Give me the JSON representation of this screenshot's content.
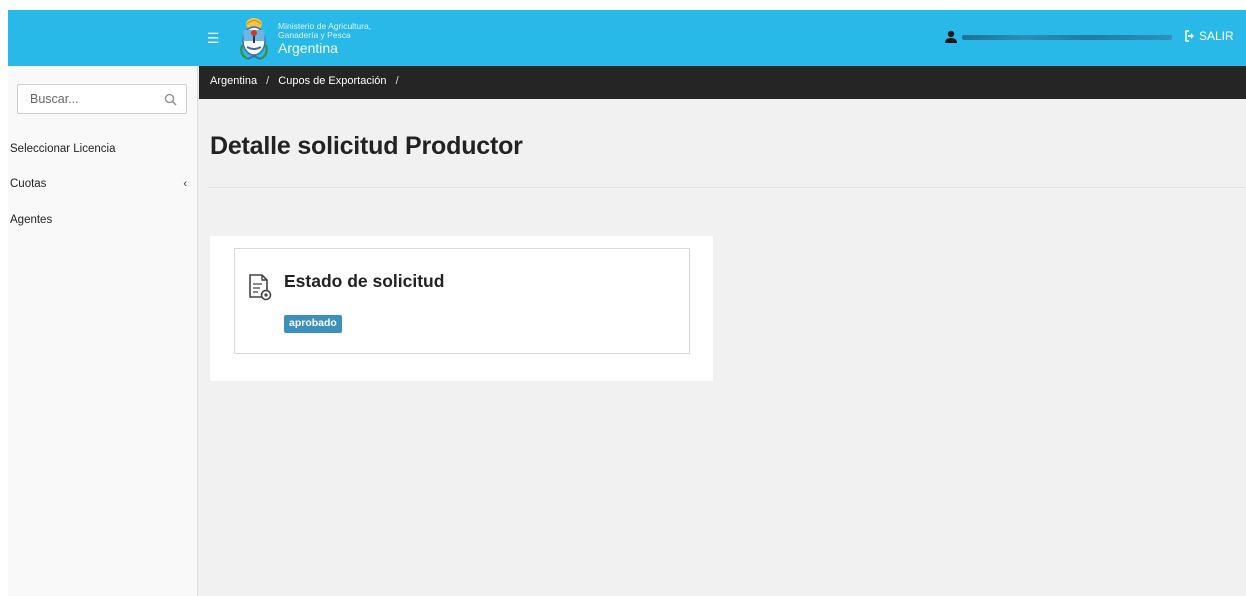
{
  "header": {
    "ministry_line1": "Ministerio de Agricultura,",
    "ministry_line2": "Ganadería y Pesca",
    "country": "Argentina",
    "logout_label": "SALIR"
  },
  "sidebar": {
    "search_placeholder": "Buscar...",
    "items": [
      {
        "label": "Seleccionar Licencia"
      },
      {
        "label": "Cuotas",
        "chevron": "‹"
      },
      {
        "label": "Agentes"
      }
    ]
  },
  "breadcrumb": {
    "items": [
      "Argentina",
      "Cupos de Exportación"
    ],
    "separator": "/"
  },
  "main": {
    "title": "Detalle solicitud Productor",
    "card": {
      "title": "Estado de solicitud",
      "status": "aprobado",
      "icon": "document-certificate-icon"
    }
  },
  "colors": {
    "topbar": "#29b9e8",
    "breadcrumb_bar": "#252525",
    "badge": "#3d8fbd",
    "background": "#f1f1f1"
  }
}
